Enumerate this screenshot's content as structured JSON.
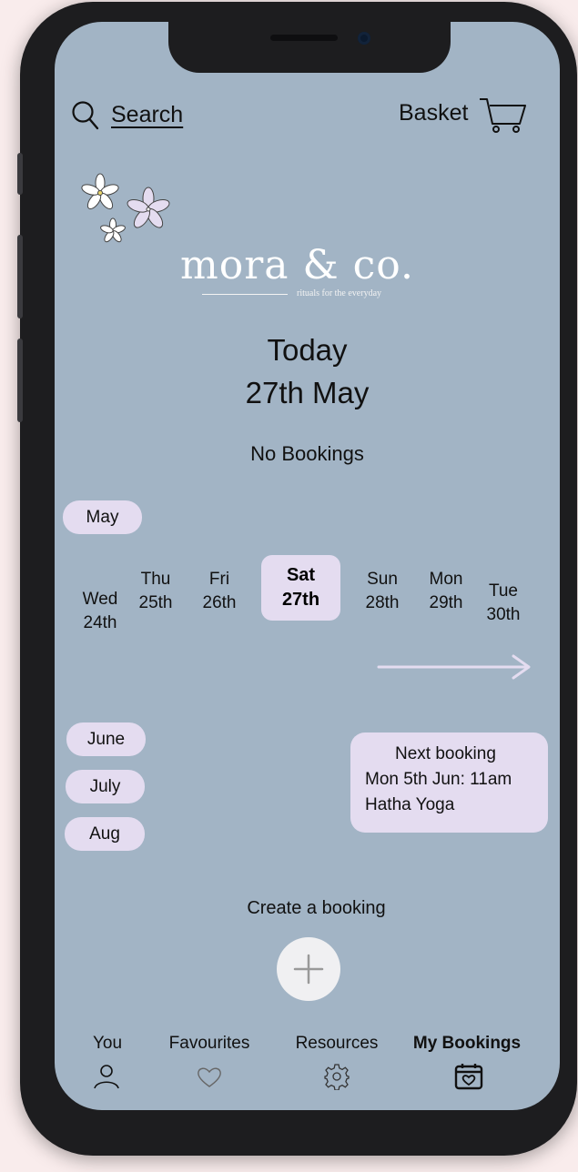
{
  "header": {
    "search_label": "Search",
    "basket_label": "Basket"
  },
  "brand": {
    "logo": "mora & co.",
    "tagline": "rituals for the everyday"
  },
  "today": {
    "line1": "Today",
    "line2": "27th May",
    "status": "No Bookings"
  },
  "calendar": {
    "current_month": "May",
    "days": [
      {
        "name": "Wed",
        "date": "24th"
      },
      {
        "name": "Thu",
        "date": "25th"
      },
      {
        "name": "Fri",
        "date": "26th"
      },
      {
        "name": "Sat",
        "date": "27th"
      },
      {
        "name": "Sun",
        "date": "28th"
      },
      {
        "name": "Mon",
        "date": "29th"
      },
      {
        "name": "Tue",
        "date": "30th"
      }
    ],
    "selected_day": "Sat 27th",
    "other_months": [
      "June",
      "July",
      "Aug"
    ]
  },
  "next_booking": {
    "title": "Next booking",
    "when": "Mon 5th Jun: 11am",
    "class": "Hatha Yoga"
  },
  "create_booking": {
    "label": "Create a booking"
  },
  "nav": {
    "items": [
      {
        "label": "You",
        "icon": "user-icon"
      },
      {
        "label": "Favourites",
        "icon": "heart-icon"
      },
      {
        "label": "Resources",
        "icon": "gear-icon"
      },
      {
        "label": "My Bookings",
        "icon": "calendar-heart-icon",
        "active": true
      }
    ]
  },
  "colors": {
    "screen_bg": "#a2b4c5",
    "pill_bg": "#e4dcf0",
    "accent_arrow": "#e4dcf0"
  }
}
